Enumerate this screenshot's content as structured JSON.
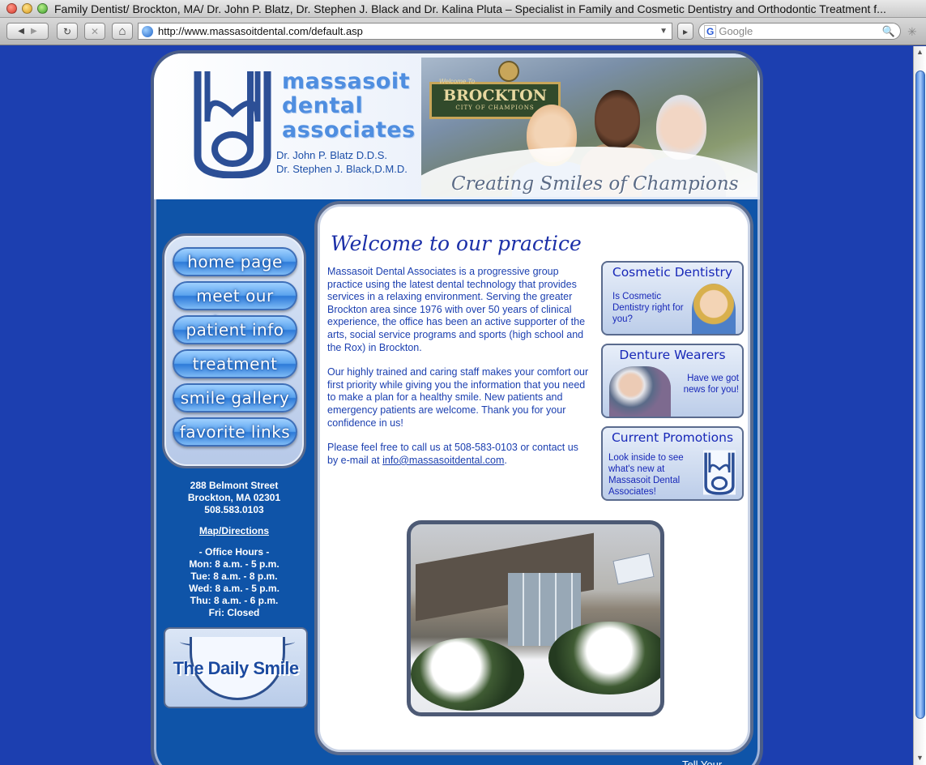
{
  "window": {
    "title": "Family Dentist/ Brockton, MA/ Dr. John P. Blatz, Dr. Stephen J. Black and Dr. Kalina Pluta – Specialist in Family and Cosmetic Dentistry and Orthodontic Treatment f..."
  },
  "browser": {
    "url": "http://www.massasoitdental.com/default.asp",
    "search_placeholder": "Google",
    "search_engine_glyph": "G",
    "back_icon": "◀",
    "forward_icon": "▶",
    "reload_icon": "↻",
    "stop_icon": "✕",
    "home_icon": "⌂",
    "rss_icon": "▸",
    "dropdown_icon": "▼",
    "magnifier_icon": "🔍"
  },
  "header": {
    "brand": [
      "massasoit",
      "dental",
      "associates"
    ],
    "doctors": [
      "Dr. John P. Blatz D.D.S.",
      "Dr. Stephen J. Black,D.M.D."
    ],
    "sign_welcome": "Welcome To",
    "sign_city": "BROCKTON",
    "sign_sub": "CITY OF CHAMPIONS",
    "tagline": "Creating Smiles of Champions"
  },
  "nav": {
    "items": [
      "home page",
      "meet our team",
      "patient info",
      "treatment",
      "smile gallery",
      "favorite links"
    ]
  },
  "contact": {
    "street": "288 Belmont Street",
    "city": "Brockton, MA 02301",
    "phone": "508.583.0103",
    "map_link": "Map/Directions",
    "hours_title": "- Office Hours -",
    "hours": [
      "Mon: 8 a.m. - 5 p.m.",
      "Tue: 8 a.m. - 8 p.m.",
      "Wed: 8 a.m. - 5 p.m.",
      "Thu: 8 a.m. - 6 p.m.",
      "Fri: Closed"
    ]
  },
  "daily_smile": {
    "label": "The Daily Smile"
  },
  "main": {
    "heading": "Welcome to our practice",
    "para1": "Massasoit Dental Associates is a progressive group practice using the latest dental technology that provides services in a relaxing environment. Serving the greater Brockton area since 1976 with over 50 years of clinical experience, the office has been an active supporter of the arts, social service programs and sports (high school and the Rox) in Brockton.",
    "para2": "Our highly trained and caring staff makes your comfort our first priority while giving you the information that you need to make a plan for a healthy smile. New patients and emergency patients are welcome. Thank you for your confidence in us!",
    "para3_before": "Please feel free to call us at 508-583-0103 or contact us by e-mail at ",
    "email": "info@massasoitdental.com",
    "para3_after": "."
  },
  "promos": {
    "cosmetic": {
      "title": "Cosmetic Dentistry",
      "body": "Is Cosmetic Dentistry right for you?"
    },
    "denture": {
      "title": "Denture Wearers",
      "body": "Have we got news for you!"
    },
    "current": {
      "title": "Current Promotions",
      "body": "Look inside to see what's new at Massasoit Dental Associates!"
    }
  },
  "footer_peek": "Tell Your",
  "colors": {
    "page_background": "#1c3fb0",
    "frame_blue": "#0f54a8",
    "text_blue": "#1b3fb0",
    "heading_navy": "#1b2fa8",
    "brand_blue": "#4f8ee0"
  }
}
